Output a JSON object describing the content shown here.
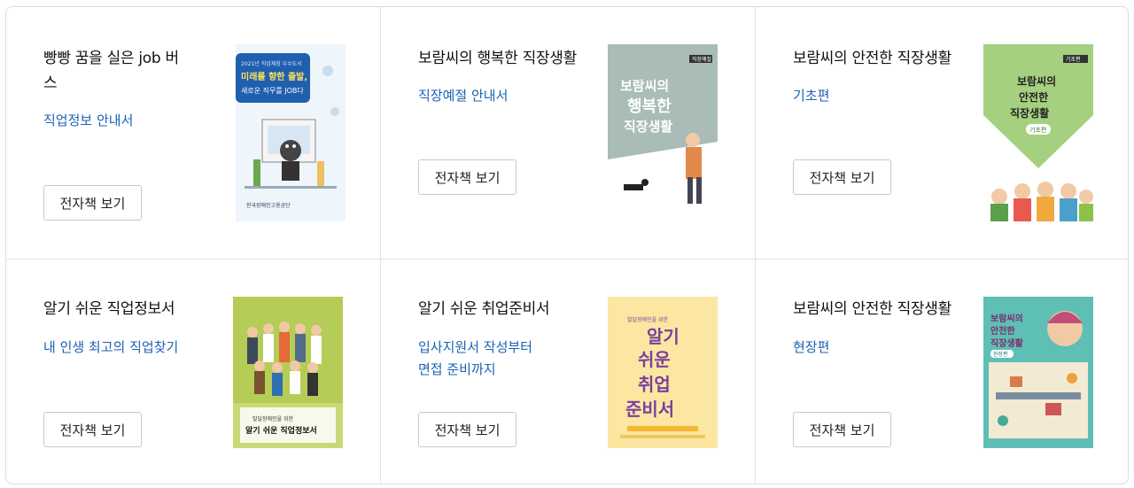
{
  "cards": [
    {
      "title": "빵빵 꿈을 실은 job 버스",
      "subtitle": "직업정보 안내서",
      "button": "전자책 보기",
      "cover": {
        "icon": "book-cover-job-bus",
        "text1": "2021년 직업체험 우수도서",
        "text2": "미래를 향한 출발,",
        "text3": "새로운 직무를 JOB다",
        "publisher": "한국장애인고용공단"
      }
    },
    {
      "title": "보람씨의 행복한 직장생활",
      "subtitle": "직장예절 안내서",
      "button": "전자책 보기",
      "cover": {
        "icon": "book-cover-happy-worklife",
        "tag": "직장예절",
        "line1": "보람씨의",
        "line2": "행복한",
        "line3": "직장생활"
      }
    },
    {
      "title": "보람씨의 안전한 직장생활",
      "subtitle": "기초편",
      "button": "전자책 보기",
      "cover": {
        "icon": "book-cover-safe-worklife-basic",
        "tag": "기초편",
        "line1": "보람씨의",
        "line2": "안전한",
        "line3": "직장생활",
        "badge": "기초편"
      }
    },
    {
      "title": "알기 쉬운 직업정보서",
      "subtitle": "내 인생 최고의 직업찾기",
      "button": "전자책 보기",
      "cover": {
        "icon": "book-cover-easy-job-info",
        "small": "발달장애인을 위한",
        "main": "알기 쉬운 직업정보서"
      }
    },
    {
      "title": "알기 쉬운 취업준비서",
      "subtitle": "입사지원서 작성부터\n면접 준비까지",
      "button": "전자책 보기",
      "cover": {
        "icon": "book-cover-easy-employment-prep",
        "small": "발달장애인을 위한",
        "w1": "알기",
        "w2": "쉬운",
        "w3": "취업",
        "w4": "준비서"
      }
    },
    {
      "title": "보람씨의 안전한 직장생활",
      "subtitle": "현장편",
      "button": "전자책 보기",
      "cover": {
        "icon": "book-cover-safe-worklife-field",
        "line1": "보람씨의",
        "line2": "안전한",
        "line3": "직장생활",
        "badge": "현장편"
      }
    }
  ],
  "colors": {
    "link": "#1a62b4",
    "border": "#e3e3e3"
  }
}
